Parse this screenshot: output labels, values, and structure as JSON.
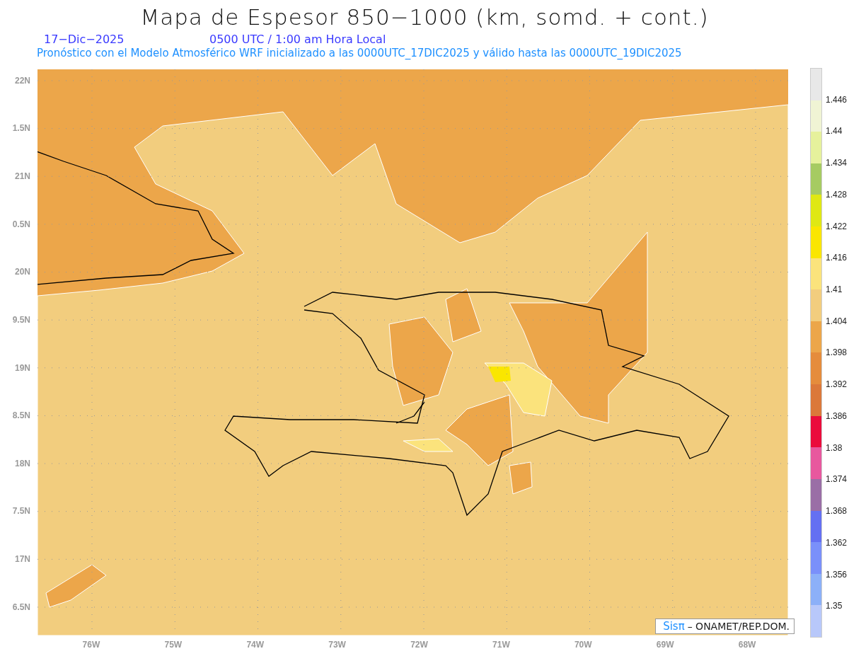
{
  "title": "Mapa de Espesor 850−1000 (km, somd. + cont.)",
  "date": "17−Dic−2025",
  "time": "0500 UTC / 1:00 am Hora Local",
  "subtitle": "Pronóstico con el Modelo Atmosférico WRF inicializado a las 0000UTC_17DIC2025 y válido hasta las  0000UTC_19DIC2025",
  "map": {
    "lat_labels": [
      "22N",
      "1.5N",
      "21N",
      "0.5N",
      "20N",
      "9.5N",
      "19N",
      "8.5N",
      "18N",
      "7.5N",
      "17N",
      "6.5N"
    ],
    "lon_labels": [
      "76W",
      "75W",
      "74W",
      "73W",
      "72W",
      "71W",
      "70W",
      "69W",
      "68W"
    ],
    "credit": {
      "logo": "Sisπ",
      "text": "– ONAMET/REP.DOM."
    }
  },
  "colorbar": {
    "boxes": [
      {
        "color": "#e8e8e8"
      },
      {
        "color": "#f0f4d4"
      },
      {
        "color": "#e6f19c"
      },
      {
        "color": "#a6cb62"
      },
      {
        "color": "#dfe814"
      },
      {
        "color": "#fae600"
      },
      {
        "color": "#fbe37c"
      },
      {
        "color": "#f2cd7e"
      },
      {
        "color": "#eca64a"
      },
      {
        "color": "#e58c3c"
      },
      {
        "color": "#db783a"
      },
      {
        "color": "#ea0c3c"
      },
      {
        "color": "#e8589e"
      },
      {
        "color": "#9a6ea6"
      },
      {
        "color": "#6470f2"
      },
      {
        "color": "#7a90fa"
      },
      {
        "color": "#8cb0f8"
      },
      {
        "color": "#b8c8fa"
      }
    ],
    "labels": [
      "1.446",
      "1.44",
      "1.434",
      "1.428",
      "1.422",
      "1.416",
      "1.41",
      "1.404",
      "1.398",
      "1.392",
      "1.386",
      "1.38",
      "1.374",
      "1.368",
      "1.362",
      "1.356",
      "1.35"
    ]
  }
}
